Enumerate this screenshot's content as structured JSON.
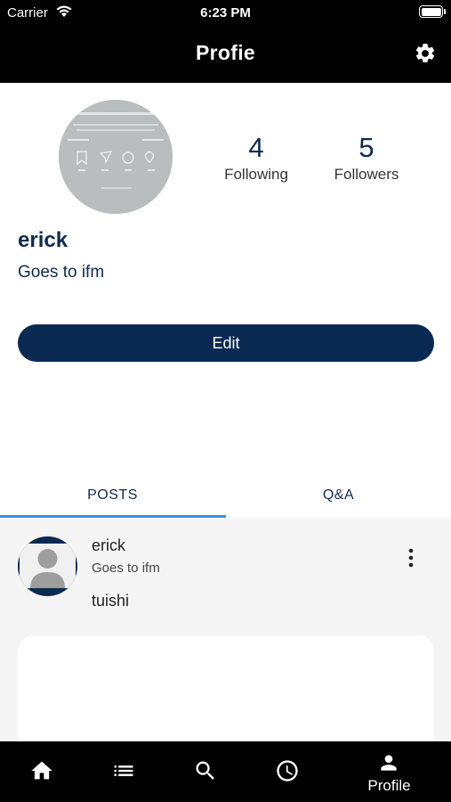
{
  "status_bar": {
    "carrier": "Carrier",
    "time": "6:23 PM"
  },
  "header": {
    "title": "Profie"
  },
  "profile": {
    "username": "erick",
    "bio": "Goes to ifm",
    "following_count": "4",
    "following_label": "Following",
    "followers_count": "5",
    "followers_label": "Followers",
    "edit_label": "Edit"
  },
  "tabs": [
    {
      "label": "POSTS",
      "active": true
    },
    {
      "label": "Q&A",
      "active": false
    }
  ],
  "posts": [
    {
      "author": "erick",
      "subtitle": "Goes to ifm",
      "text": "tuishi"
    }
  ],
  "bottom_nav": {
    "items": [
      "home-icon",
      "list-icon",
      "search-icon",
      "history-icon",
      "profile-icon"
    ],
    "active_label": "Profile"
  },
  "colors": {
    "navy": "#0a2a52",
    "tab_indicator": "#3d8fe0",
    "bar": "#000000"
  }
}
